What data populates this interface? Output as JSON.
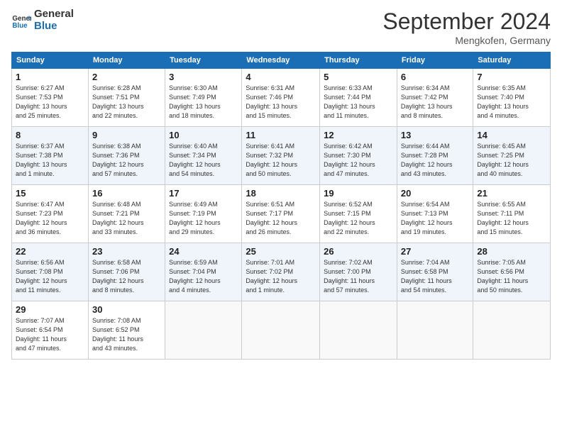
{
  "header": {
    "logo_line1": "General",
    "logo_line2": "Blue",
    "month": "September 2024",
    "location": "Mengkofen, Germany"
  },
  "days_of_week": [
    "Sunday",
    "Monday",
    "Tuesday",
    "Wednesday",
    "Thursday",
    "Friday",
    "Saturday"
  ],
  "weeks": [
    [
      {
        "day": "1",
        "info": "Sunrise: 6:27 AM\nSunset: 7:53 PM\nDaylight: 13 hours\nand 25 minutes."
      },
      {
        "day": "2",
        "info": "Sunrise: 6:28 AM\nSunset: 7:51 PM\nDaylight: 13 hours\nand 22 minutes."
      },
      {
        "day": "3",
        "info": "Sunrise: 6:30 AM\nSunset: 7:49 PM\nDaylight: 13 hours\nand 18 minutes."
      },
      {
        "day": "4",
        "info": "Sunrise: 6:31 AM\nSunset: 7:46 PM\nDaylight: 13 hours\nand 15 minutes."
      },
      {
        "day": "5",
        "info": "Sunrise: 6:33 AM\nSunset: 7:44 PM\nDaylight: 13 hours\nand 11 minutes."
      },
      {
        "day": "6",
        "info": "Sunrise: 6:34 AM\nSunset: 7:42 PM\nDaylight: 13 hours\nand 8 minutes."
      },
      {
        "day": "7",
        "info": "Sunrise: 6:35 AM\nSunset: 7:40 PM\nDaylight: 13 hours\nand 4 minutes."
      }
    ],
    [
      {
        "day": "8",
        "info": "Sunrise: 6:37 AM\nSunset: 7:38 PM\nDaylight: 13 hours\nand 1 minute."
      },
      {
        "day": "9",
        "info": "Sunrise: 6:38 AM\nSunset: 7:36 PM\nDaylight: 12 hours\nand 57 minutes."
      },
      {
        "day": "10",
        "info": "Sunrise: 6:40 AM\nSunset: 7:34 PM\nDaylight: 12 hours\nand 54 minutes."
      },
      {
        "day": "11",
        "info": "Sunrise: 6:41 AM\nSunset: 7:32 PM\nDaylight: 12 hours\nand 50 minutes."
      },
      {
        "day": "12",
        "info": "Sunrise: 6:42 AM\nSunset: 7:30 PM\nDaylight: 12 hours\nand 47 minutes."
      },
      {
        "day": "13",
        "info": "Sunrise: 6:44 AM\nSunset: 7:28 PM\nDaylight: 12 hours\nand 43 minutes."
      },
      {
        "day": "14",
        "info": "Sunrise: 6:45 AM\nSunset: 7:25 PM\nDaylight: 12 hours\nand 40 minutes."
      }
    ],
    [
      {
        "day": "15",
        "info": "Sunrise: 6:47 AM\nSunset: 7:23 PM\nDaylight: 12 hours\nand 36 minutes."
      },
      {
        "day": "16",
        "info": "Sunrise: 6:48 AM\nSunset: 7:21 PM\nDaylight: 12 hours\nand 33 minutes."
      },
      {
        "day": "17",
        "info": "Sunrise: 6:49 AM\nSunset: 7:19 PM\nDaylight: 12 hours\nand 29 minutes."
      },
      {
        "day": "18",
        "info": "Sunrise: 6:51 AM\nSunset: 7:17 PM\nDaylight: 12 hours\nand 26 minutes."
      },
      {
        "day": "19",
        "info": "Sunrise: 6:52 AM\nSunset: 7:15 PM\nDaylight: 12 hours\nand 22 minutes."
      },
      {
        "day": "20",
        "info": "Sunrise: 6:54 AM\nSunset: 7:13 PM\nDaylight: 12 hours\nand 19 minutes."
      },
      {
        "day": "21",
        "info": "Sunrise: 6:55 AM\nSunset: 7:11 PM\nDaylight: 12 hours\nand 15 minutes."
      }
    ],
    [
      {
        "day": "22",
        "info": "Sunrise: 6:56 AM\nSunset: 7:08 PM\nDaylight: 12 hours\nand 11 minutes."
      },
      {
        "day": "23",
        "info": "Sunrise: 6:58 AM\nSunset: 7:06 PM\nDaylight: 12 hours\nand 8 minutes."
      },
      {
        "day": "24",
        "info": "Sunrise: 6:59 AM\nSunset: 7:04 PM\nDaylight: 12 hours\nand 4 minutes."
      },
      {
        "day": "25",
        "info": "Sunrise: 7:01 AM\nSunset: 7:02 PM\nDaylight: 12 hours\nand 1 minute."
      },
      {
        "day": "26",
        "info": "Sunrise: 7:02 AM\nSunset: 7:00 PM\nDaylight: 11 hours\nand 57 minutes."
      },
      {
        "day": "27",
        "info": "Sunrise: 7:04 AM\nSunset: 6:58 PM\nDaylight: 11 hours\nand 54 minutes."
      },
      {
        "day": "28",
        "info": "Sunrise: 7:05 AM\nSunset: 6:56 PM\nDaylight: 11 hours\nand 50 minutes."
      }
    ],
    [
      {
        "day": "29",
        "info": "Sunrise: 7:07 AM\nSunset: 6:54 PM\nDaylight: 11 hours\nand 47 minutes."
      },
      {
        "day": "30",
        "info": "Sunrise: 7:08 AM\nSunset: 6:52 PM\nDaylight: 11 hours\nand 43 minutes."
      },
      {
        "day": "",
        "info": ""
      },
      {
        "day": "",
        "info": ""
      },
      {
        "day": "",
        "info": ""
      },
      {
        "day": "",
        "info": ""
      },
      {
        "day": "",
        "info": ""
      }
    ]
  ]
}
